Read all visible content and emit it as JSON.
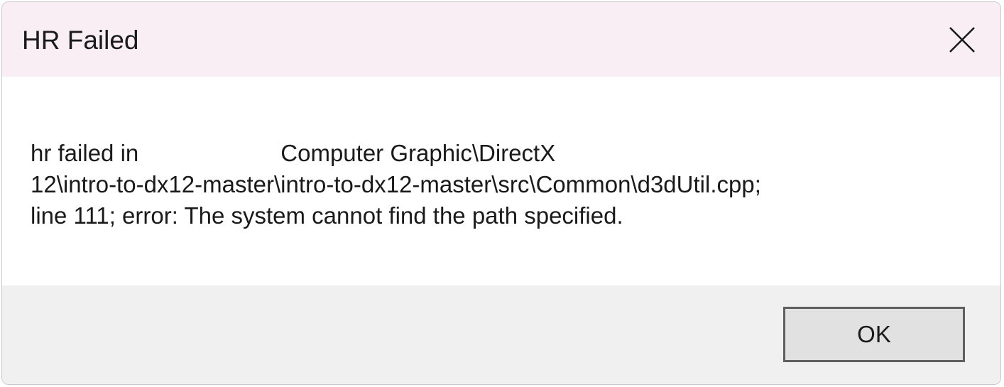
{
  "dialog": {
    "title": "HR Failed",
    "close_icon": "close-icon",
    "message_lines": [
      {
        "prefix": "hr failed in",
        "rest": "Computer Graphic\\DirectX"
      },
      "12\\intro-to-dx12-master\\intro-to-dx12-master\\src\\Common\\d3dUtil.cpp;",
      "line 111; error: The system cannot find the path specified."
    ],
    "ok_label": "OK"
  }
}
